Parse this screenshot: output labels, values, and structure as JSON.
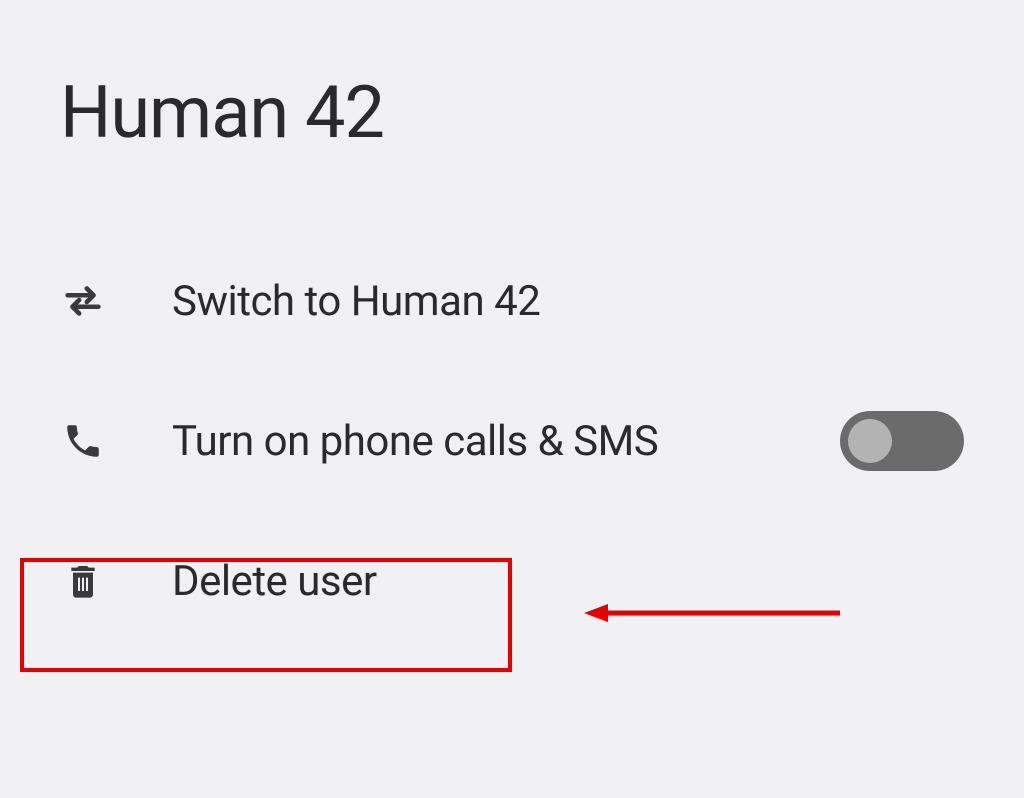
{
  "title": "Human 42",
  "options": {
    "switch": {
      "label": "Switch to Human 42"
    },
    "phone": {
      "label": "Turn on phone calls & SMS",
      "toggle_on": false
    },
    "delete": {
      "label": "Delete user"
    }
  },
  "annotation": {
    "highlight": "delete-user-row",
    "arrow_target": "delete-user-row"
  },
  "colors": {
    "highlight": "#e60000",
    "text": "#2a2a2e",
    "toggle_track": "#6b6b6b",
    "toggle_knob": "#b3b3b3",
    "background": "#f1f0f3"
  }
}
